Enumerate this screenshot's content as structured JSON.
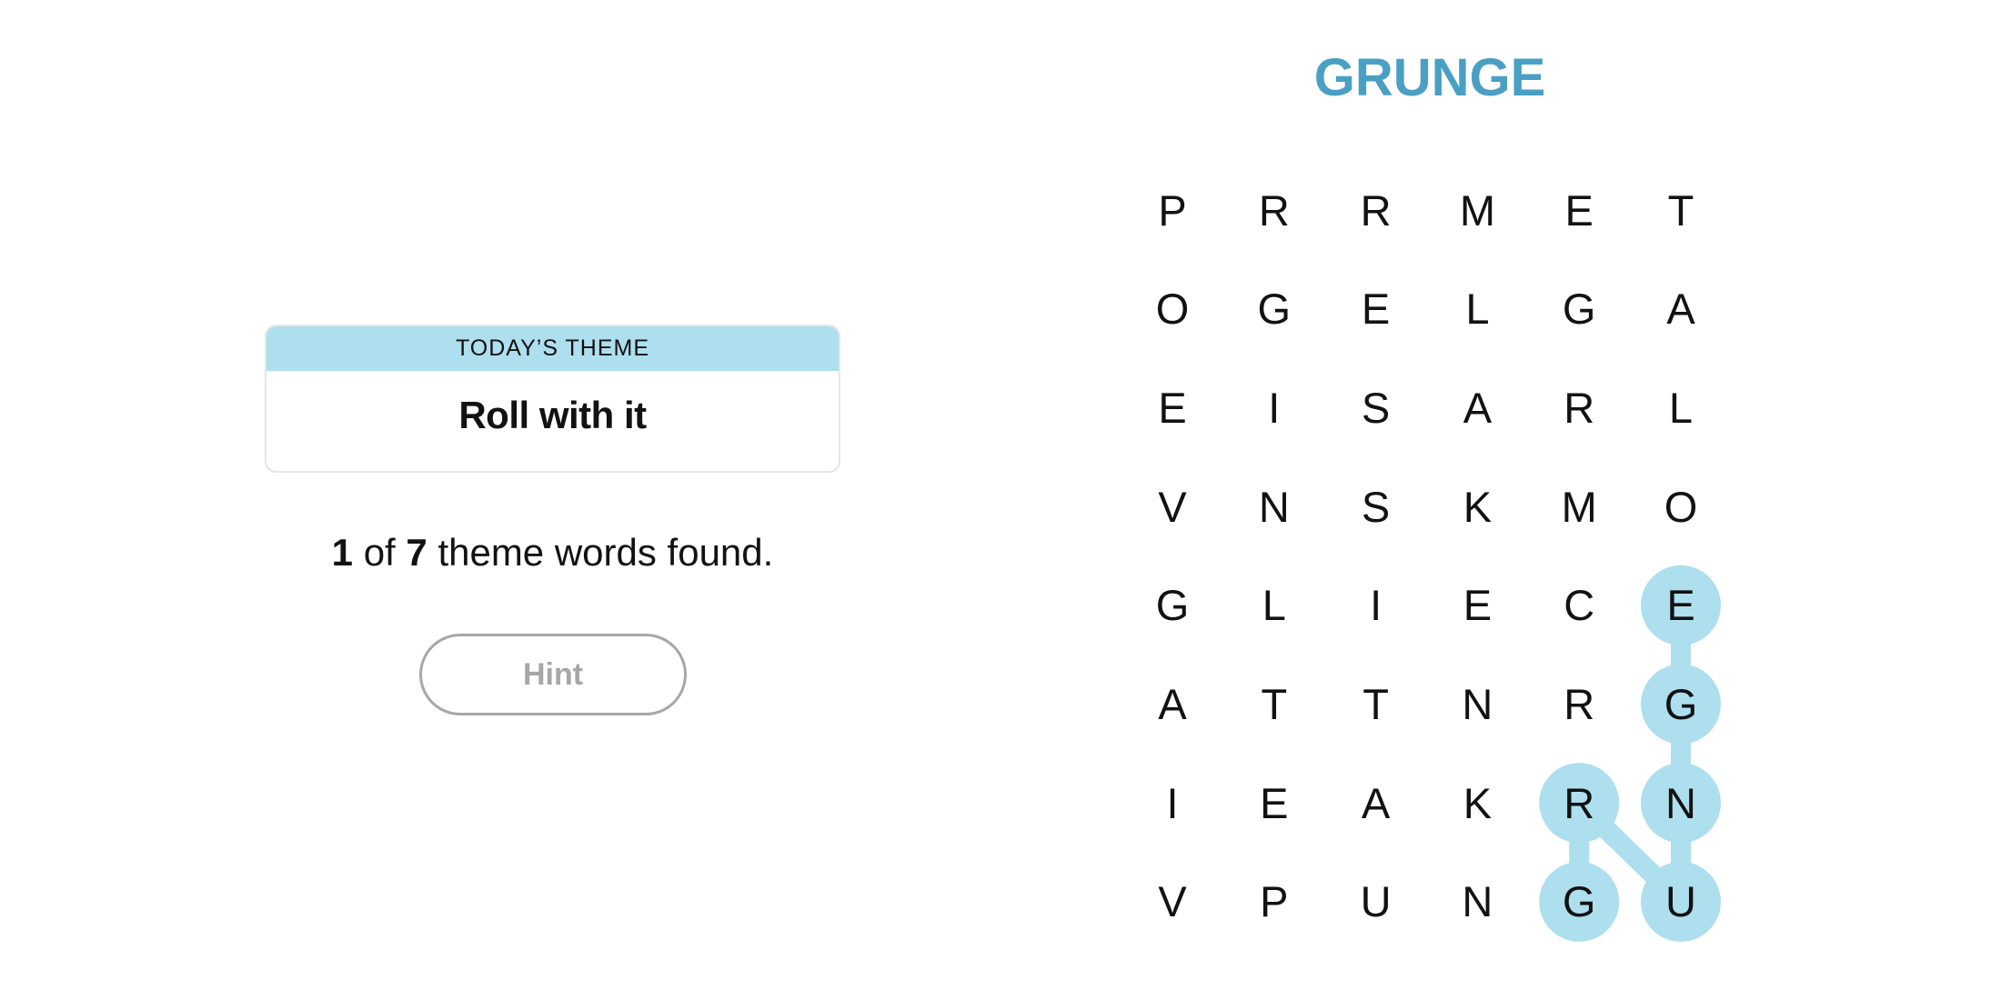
{
  "theme_card": {
    "header": "TODAY’S THEME",
    "theme": "Roll with it"
  },
  "progress": {
    "found": "1",
    "of_label": "of",
    "total": "7",
    "suffix": "theme words found."
  },
  "hint_button": {
    "label": "Hint",
    "enabled": false
  },
  "current_word": "GRUNGE",
  "colors": {
    "highlight": "#aedfee",
    "current_word": "#4a9fc4",
    "letter": "#121212",
    "hint_disabled": "#a7a7a7"
  },
  "grid": {
    "rows": 8,
    "cols": 6,
    "letters": [
      [
        "P",
        "R",
        "R",
        "M",
        "E",
        "T"
      ],
      [
        "O",
        "G",
        "E",
        "L",
        "G",
        "A"
      ],
      [
        "E",
        "I",
        "S",
        "A",
        "R",
        "L"
      ],
      [
        "V",
        "N",
        "S",
        "K",
        "M",
        "O"
      ],
      [
        "G",
        "L",
        "I",
        "E",
        "C",
        "E"
      ],
      [
        "A",
        "T",
        "T",
        "N",
        "R",
        "G"
      ],
      [
        "I",
        "E",
        "A",
        "K",
        "R",
        "N"
      ],
      [
        "V",
        "P",
        "U",
        "N",
        "G",
        "U"
      ]
    ],
    "selected_path": [
      [
        7,
        4
      ],
      [
        6,
        4
      ],
      [
        7,
        5
      ],
      [
        6,
        5
      ],
      [
        5,
        5
      ],
      [
        4,
        5
      ]
    ]
  }
}
